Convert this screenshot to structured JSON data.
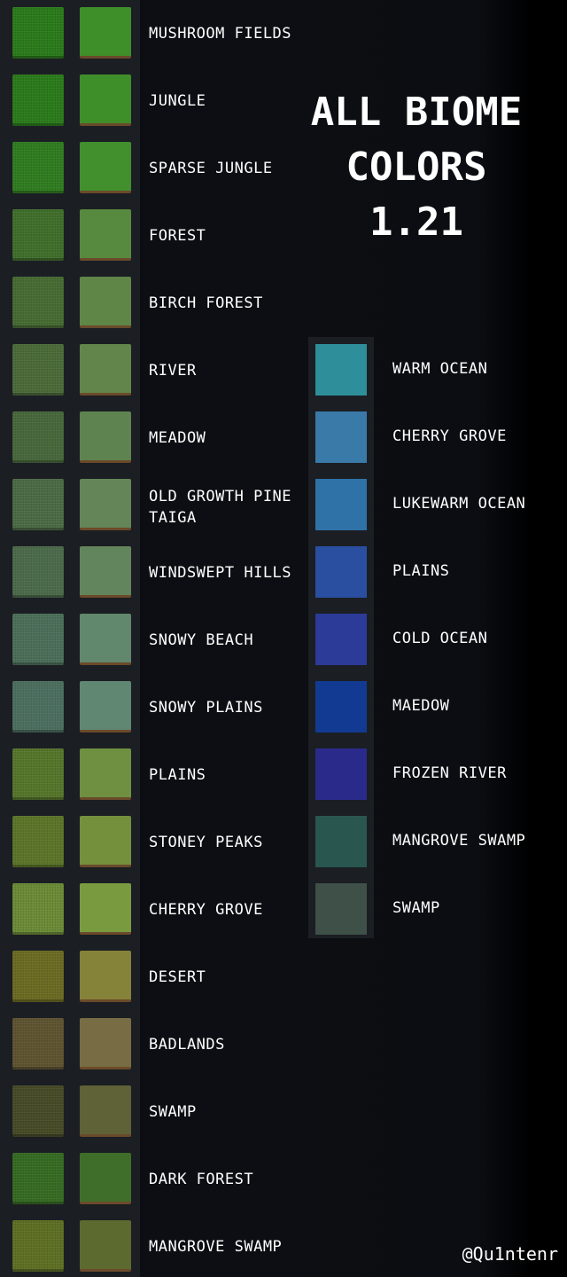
{
  "title": {
    "line1": "ALL BIOME",
    "line2": "COLORS",
    "line3": "1.21"
  },
  "credit": "@Qu1ntenr",
  "grass_biomes": [
    {
      "name": "MUSHROOM FIELDS",
      "top_color": "#2a7a1a",
      "side_color": "#3e8e2a"
    },
    {
      "name": "JUNGLE",
      "top_color": "#2a7a1a",
      "side_color": "#3e8e2a"
    },
    {
      "name": "SPARSE JUNGLE",
      "top_color": "#2f7c1f",
      "side_color": "#428f2e"
    },
    {
      "name": "FOREST",
      "top_color": "#3f6e2a",
      "side_color": "#578a3e"
    },
    {
      "name": "BIRCH FOREST",
      "top_color": "#466a32",
      "side_color": "#5f8647"
    },
    {
      "name": "RIVER",
      "top_color": "#4a6a38",
      "side_color": "#62854c"
    },
    {
      "name": "MEADOW",
      "top_color": "#47673a",
      "side_color": "#5f8350"
    },
    {
      "name": "OLD GROWTH PINE TAIGA",
      "top_color": "#4b6a44",
      "side_color": "#638557"
    },
    {
      "name": "WINDSWEPT HILLS",
      "top_color": "#4b6a4a",
      "side_color": "#63855d"
    },
    {
      "name": "SNOWY BEACH",
      "top_color": "#4b6e58",
      "side_color": "#61876d"
    },
    {
      "name": "SNOWY PLAINS",
      "top_color": "#4b6e5e",
      "side_color": "#608772"
    },
    {
      "name": "PLAINS",
      "top_color": "#55752a",
      "side_color": "#6e9040"
    },
    {
      "name": "STONEY PEAKS",
      "top_color": "#5b7428",
      "side_color": "#74903c"
    },
    {
      "name": "CHERRY GROVE",
      "top_color": "#6a8a35",
      "side_color": "#7a9a40"
    },
    {
      "name": "DESERT",
      "top_color": "#6b6a22",
      "side_color": "#85823a"
    },
    {
      "name": "BADLANDS",
      "top_color": "#5e5330",
      "side_color": "#786c44"
    },
    {
      "name": "SWAMP",
      "top_color": "#464a26",
      "side_color": "#5e6236"
    },
    {
      "name": "DARK FOREST",
      "top_color": "#356a22",
      "side_color": "#3f6e2a"
    },
    {
      "name": "MANGROVE SWAMP",
      "top_color": "#5d6f23",
      "side_color": "#5c6a30"
    }
  ],
  "water_biomes": [
    {
      "name": "WARM OCEAN",
      "color": "#2e8f9a"
    },
    {
      "name": "CHERRY GROVE",
      "color": "#3a7aa8"
    },
    {
      "name": "LUKEWARM OCEAN",
      "color": "#2e72a8"
    },
    {
      "name": "PLAINS",
      "color": "#2a4fa0"
    },
    {
      "name": "COLD OCEAN",
      "color": "#2c3a98"
    },
    {
      "name": "MAEDOW",
      "color": "#123a92"
    },
    {
      "name": "FROZEN RIVER",
      "color": "#2a2a8a"
    },
    {
      "name": "MANGROVE SWAMP",
      "color": "#2a5650"
    },
    {
      "name": "SWAMP",
      "color": "#3e5048"
    }
  ]
}
